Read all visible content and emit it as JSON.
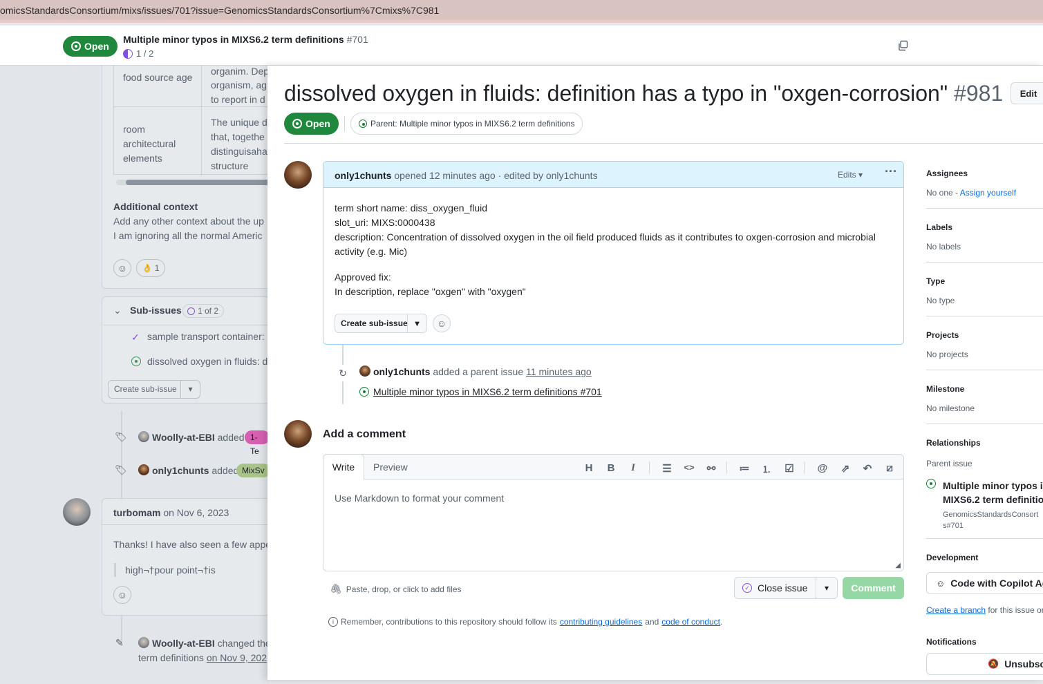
{
  "browser": {
    "url": "omicsStandardsConsortium/mixs/issues/701?issue=GenomicsStandardsConsortium%7Cmixs%7C981"
  },
  "sticky_header": {
    "state": "Open",
    "title": "Multiple minor typos in MIXS6.2 term definitions",
    "number": "#701",
    "progress": "1 / 2"
  },
  "background": {
    "table": [
      {
        "name": "food source age",
        "desc": [
          "organim. Dep",
          "organism, ag",
          "to report in d"
        ]
      },
      {
        "name": [
          "room",
          "architectural",
          "elements"
        ],
        "desc": [
          "The unique d",
          "that, togethe",
          "distinguisaha",
          "structure"
        ]
      }
    ],
    "additional_context_title": "Additional context",
    "additional_context_lines": [
      "Add any other context about the up",
      "I am ignoring all the normal Americ"
    ],
    "reaction_count": "1",
    "subissues_title": "Sub-issues",
    "subissues_progress": "1 of 2",
    "subissues": [
      "sample transport container:",
      "dissolved oxygen in fluids: d"
    ],
    "create_subissue": "Create sub-issue",
    "events": [
      {
        "user": "Woolly-at-EBI",
        "action": "added",
        "label": "1-Te"
      },
      {
        "user": "only1chunts",
        "action": "added",
        "label": "MixSv"
      }
    ],
    "comment": {
      "user": "turbomam",
      "date": "on Nov 6, 2023",
      "text": "Thanks! I have also seen a few appe",
      "quote": "high¬†pour point¬†is"
    },
    "rename": {
      "user": "Woolly-at-EBI",
      "action": "changed the",
      "line2": "term definitions",
      "date": "on Nov 9, 202"
    }
  },
  "issue": {
    "title": "dissolved oxygen in fluids: definition has a typo in \"oxgen-corrosion\"",
    "number": "#981",
    "edit_label": "Edit",
    "state": "Open",
    "parent_chip": "Parent: Multiple minor typos in MIXS6.2 term definitions"
  },
  "body_comment": {
    "author": "only1chunts",
    "meta": "opened 12 minutes ago · edited by only1chunts",
    "edits_label": "Edits",
    "lines": [
      "term short name: diss_oxygen_fluid",
      "slot_uri: MIXS:0000438",
      "description: Concentration of dissolved oxygen in the oil field produced fluids as it contributes to oxgen-corrosion and microbial",
      "activity (e.g. Mic)"
    ],
    "fix_lines": [
      "Approved fix:",
      "In description, replace \"oxgen\" with \"oxygen\""
    ],
    "create_subissue": "Create sub-issue"
  },
  "timeline_event": {
    "user": "only1chunts",
    "action": "added a parent issue",
    "time": "11 minutes ago",
    "parent_link": "Multiple minor typos in MIXS6.2 term definitions #701"
  },
  "comment_box": {
    "heading": "Add a comment",
    "tab_write": "Write",
    "tab_preview": "Preview",
    "placeholder": "Use Markdown to format your comment",
    "attach": "Paste, drop, or click to add files",
    "close_issue": "Close issue",
    "comment": "Comment",
    "notice_pre": "Remember, contributions to this repository should follow its",
    "notice_link1": "contributing guidelines",
    "notice_and": "and",
    "notice_link2": "code of conduct",
    "notice_end": "."
  },
  "sidebar": {
    "assignees_h": "Assignees",
    "assignees_none": "No one -",
    "assign_yourself": "Assign yourself",
    "labels_h": "Labels",
    "labels_v": "No labels",
    "type_h": "Type",
    "type_v": "No type",
    "projects_h": "Projects",
    "projects_v": "No projects",
    "milestone_h": "Milestone",
    "milestone_v": "No milestone",
    "relationships_h": "Relationships",
    "parent_issue": "Parent issue",
    "parent_title_1": "Multiple minor typos ir",
    "parent_title_2": "MIXS6.2 term definitior",
    "parent_repo_1": "GenomicsStandardsConsort",
    "parent_repo_2": "s#701",
    "development_h": "Development",
    "copilot": "Code with Copilot Ag",
    "create_branch": "Create a branch",
    "branch_rest": "for this issue or",
    "notifications_h": "Notifications",
    "unsubscribe": "Unsubscr"
  }
}
